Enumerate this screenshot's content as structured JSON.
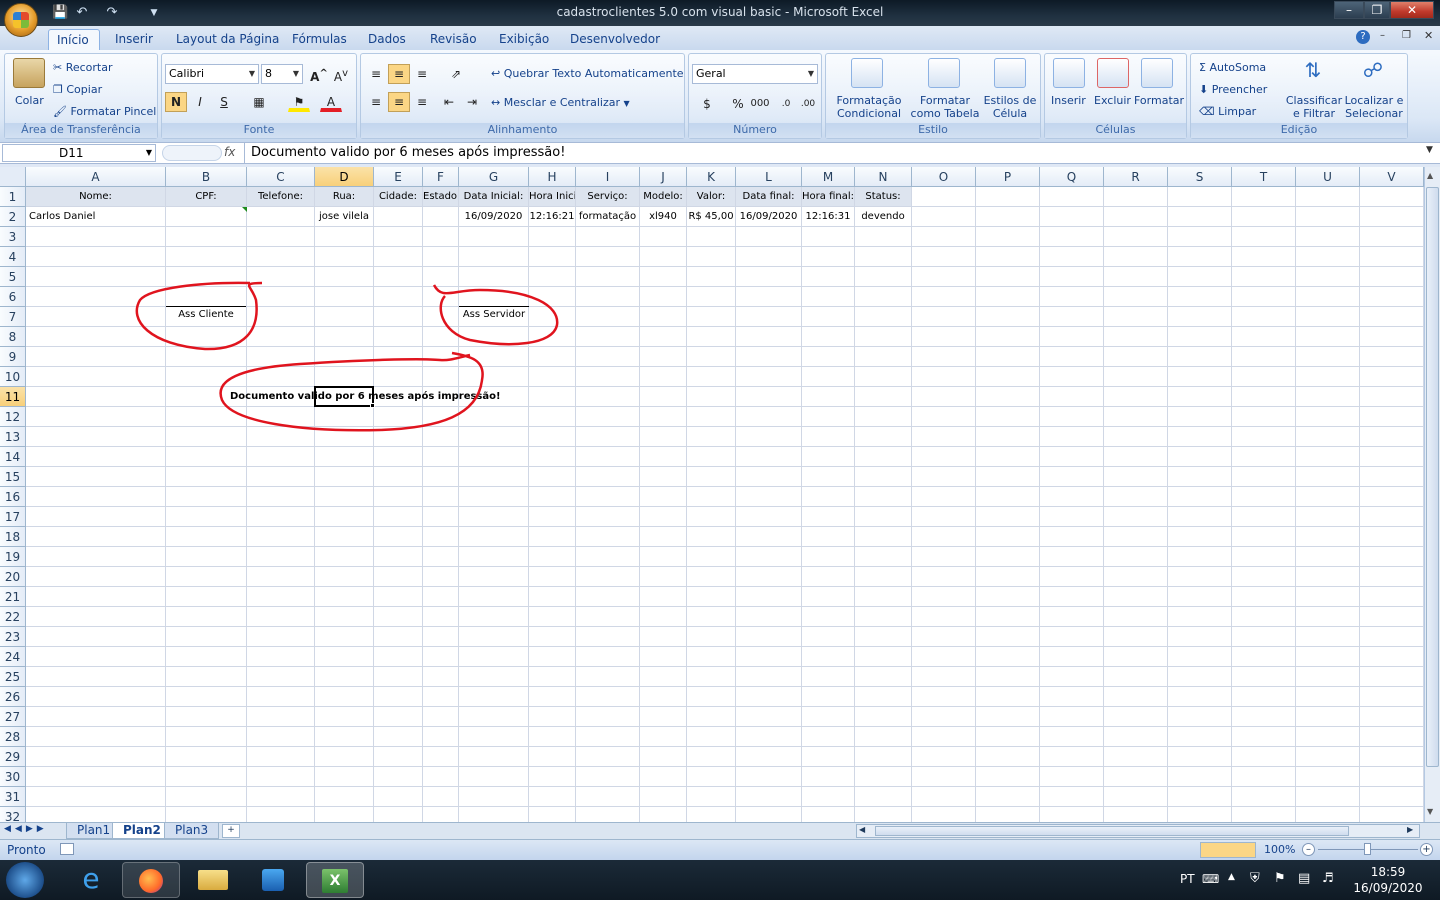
{
  "window": {
    "title": "cadastroclientes 5.0 com visual basic  -  Microsoft Excel"
  },
  "ribbon_tabs": [
    "Início",
    "Inserir",
    "Layout da Página",
    "Fórmulas",
    "Dados",
    "Revisão",
    "Exibição",
    "Desenvolvedor"
  ],
  "clipboard": {
    "paste": "Colar",
    "cut": "Recortar",
    "copy": "Copiar",
    "format_painter": "Formatar Pincel",
    "label": "Área de Transferência"
  },
  "font": {
    "name": "Calibri",
    "size": "8",
    "bold": "N",
    "italic": "I",
    "underline": "S",
    "label": "Fonte"
  },
  "alignment": {
    "wrap": "Quebrar Texto Automaticamente",
    "merge": "Mesclar e Centralizar",
    "label": "Alinhamento"
  },
  "number": {
    "format": "Geral",
    "percent": "%",
    "thousands": "000",
    "label": "Número"
  },
  "styles": {
    "conditional": [
      "Formatação",
      "Condicional"
    ],
    "table": [
      "Formatar",
      "como Tabela"
    ],
    "cell": [
      "Estilos de",
      "Célula"
    ],
    "label": "Estilo"
  },
  "cells": {
    "insert": "Inserir",
    "delete": "Excluir",
    "format": "Formatar",
    "label": "Células"
  },
  "editing": {
    "autosum": "AutoSoma",
    "fill": "Preencher",
    "clear": "Limpar",
    "sort": [
      "Classificar",
      "e Filtrar"
    ],
    "find": [
      "Localizar e",
      "Selecionar"
    ],
    "label": "Edição"
  },
  "formula_bar": {
    "name_box": "D11",
    "fx": "fx",
    "value": "Documento valido por 6 meses após impressão!"
  },
  "columns": [
    "A",
    "B",
    "C",
    "D",
    "E",
    "F",
    "G",
    "H",
    "I",
    "J",
    "K",
    "L",
    "M",
    "N",
    "O",
    "P",
    "Q",
    "R",
    "S",
    "T",
    "U",
    "V"
  ],
  "rows": [
    "1",
    "2",
    "3",
    "4",
    "5",
    "6",
    "7",
    "8",
    "9",
    "10",
    "11",
    "12",
    "13",
    "14",
    "15",
    "16",
    "17",
    "18",
    "19",
    "20",
    "21",
    "22",
    "23",
    "24",
    "25",
    "26",
    "27",
    "28",
    "29",
    "30",
    "31",
    "32"
  ],
  "header_row": [
    "Nome:",
    "CPF:",
    "Telefone:",
    "Rua:",
    "Cidade:",
    "Estado:",
    "Data Inicial:",
    "Hora Inicia",
    "Serviço:",
    "Modelo:",
    "Valor:",
    "Data final:",
    "Hora final:",
    "Status:"
  ],
  "data_row": [
    "Carlos Daniel",
    "",
    "",
    "jose vilela",
    "",
    "",
    "16/09/2020",
    "12:16:21",
    "formatação",
    "xl940",
    "R$ 45,00",
    "16/09/2020",
    "12:16:31",
    "devendo"
  ],
  "signatures": {
    "client": "Ass Cliente",
    "server": "Ass Servidor"
  },
  "notice": "Documento valido por 6 meses após impressão!",
  "sheets": [
    "Plan1",
    "Plan2",
    "Plan3"
  ],
  "status": {
    "ready": "Pronto",
    "zoom": "100%"
  },
  "tray": {
    "lang": "PT",
    "time": "18:59",
    "date": "16/09/2020"
  },
  "colors": {
    "annotation": "#e0141e",
    "selection": "#000000",
    "tab_text": "#15428b"
  }
}
